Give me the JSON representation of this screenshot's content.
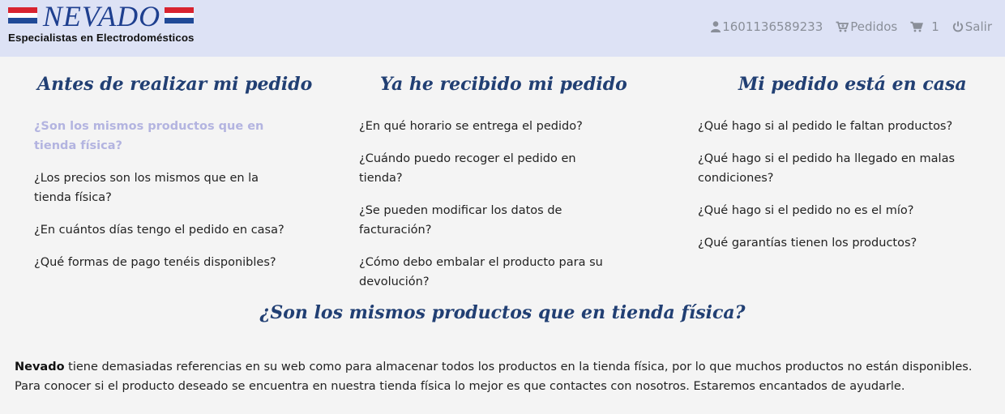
{
  "brand": {
    "name": "NEVADO",
    "tagline": "Especialistas en Electrodomésticos",
    "colors": {
      "red": "#d8232f",
      "blue": "#1e3f8f",
      "header_bg": "#dde2f5"
    }
  },
  "nav": {
    "user": {
      "icon": "user-icon",
      "label": "1601136589233"
    },
    "orders": {
      "icon": "cart-arrow-icon",
      "label": "Pedidos"
    },
    "cart": {
      "icon": "cart-icon",
      "count": "1"
    },
    "logout": {
      "icon": "power-icon",
      "label": "Salir"
    }
  },
  "columns": [
    {
      "title": "Antes de realizar mi pedido",
      "questions": [
        "¿Son los mismos productos que en tienda física?",
        "¿Los precios son los mismos que en la tienda física?",
        "¿En cuántos días tengo el pedido en casa?",
        "¿Qué formas de pago tenéis disponibles?"
      ]
    },
    {
      "title": "Ya he recibido mi pedido",
      "questions": [
        "¿En qué horario se entrega el pedido?",
        "¿Cuándo puedo recoger el pedido en tienda?",
        "¿Se pueden modificar los datos de facturación?",
        "¿Cómo debo embalar el producto para su devolución?"
      ]
    },
    {
      "title": "Mi pedido está en casa",
      "questions": [
        "¿Qué hago si al pedido le faltan productos?",
        "¿Qué hago si el pedido ha llegado en malas condiciones?",
        "¿Qué hago si el pedido no es el mío?",
        "¿Qué garantías tienen los productos?"
      ]
    }
  ],
  "active_question": "¿Son los mismos productos que en tienda física?",
  "answer": {
    "title": "¿Son los mismos productos que en tienda física?",
    "brand_lead": "Nevado",
    "text": " tiene demasiadas referencias en su web como para almacenar todos los productos en la tienda física, por lo que muchos productos no están disponibles. Para conocer si el producto deseado se encuentra en nuestra tienda física lo mejor es que contactes con nosotros. Estaremos encantados de ayudarle."
  }
}
